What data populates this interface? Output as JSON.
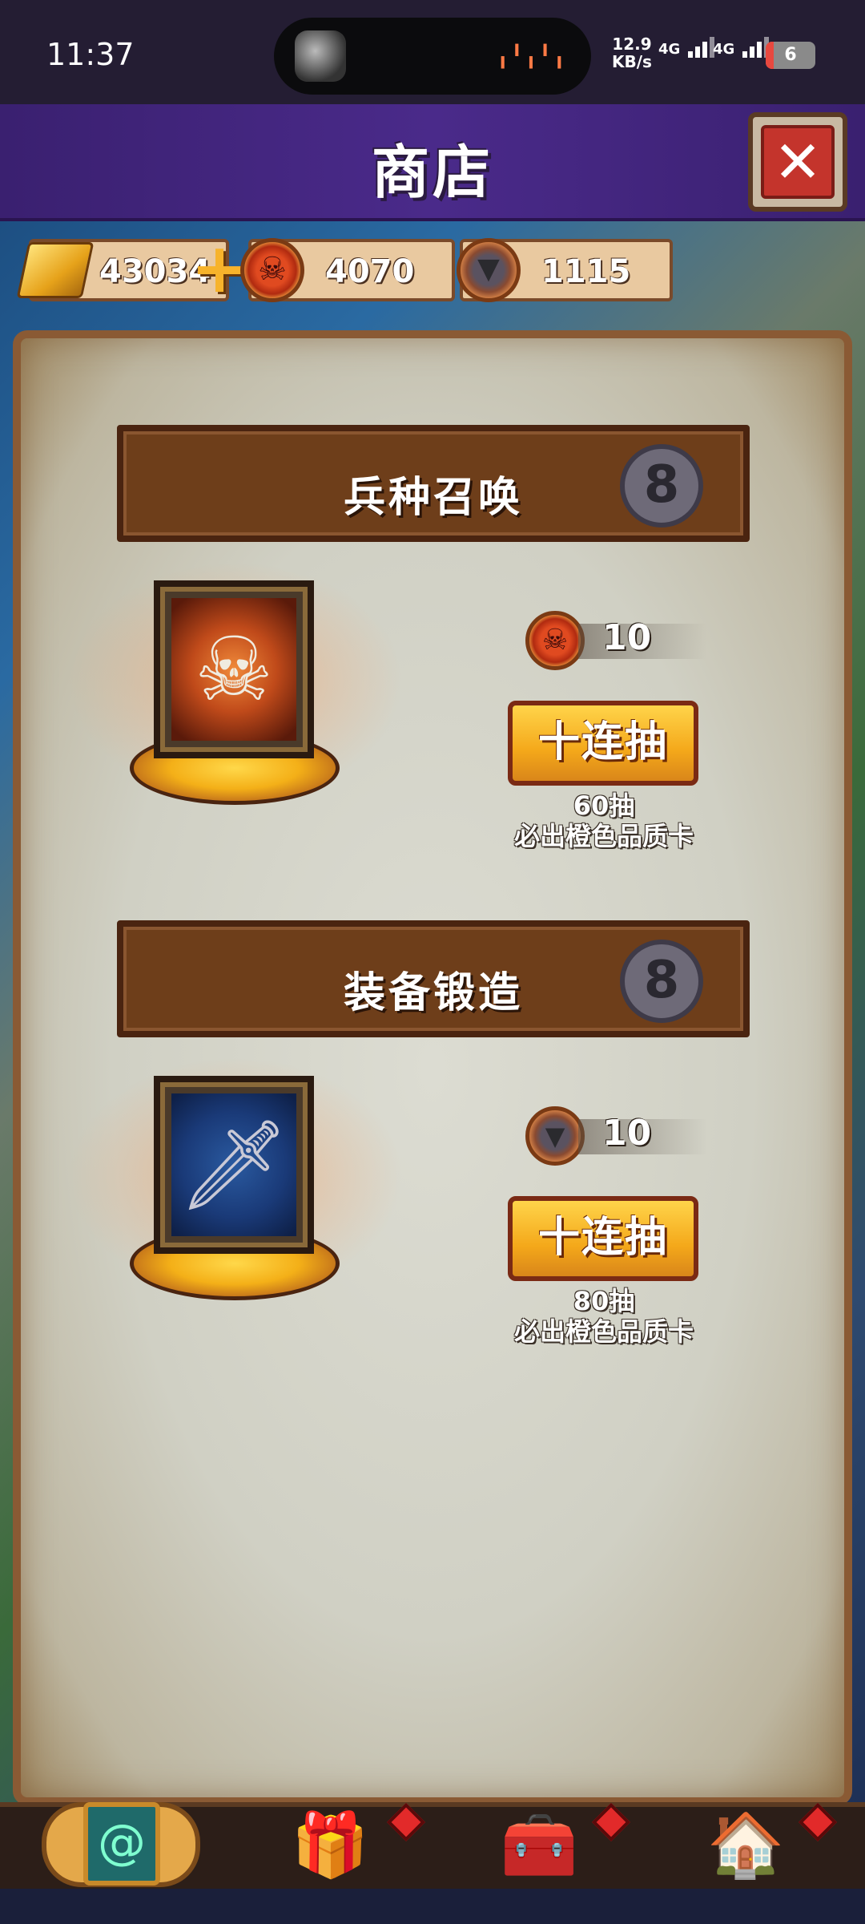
{
  "status_bar": {
    "time": "11:37",
    "net_speed_value": "12.9",
    "net_speed_unit": "KB/s",
    "signal1": "4G",
    "signal2": "4G",
    "battery": "6"
  },
  "header": {
    "title": "商店",
    "close_icon": "close-x-icon"
  },
  "resources": {
    "gold": "43034",
    "demon_token": "4070",
    "anvil_token": "1115"
  },
  "sections": [
    {
      "title": "兵种召唤",
      "badge": "8",
      "card_art": "skeleton-warrior",
      "cost": "10",
      "cost_icon": "demon-coin-icon",
      "button_label": "十连抽",
      "note_line1": "60抽",
      "note_line2": "必出橙色品质卡"
    },
    {
      "title": "装备锻造",
      "badge": "8",
      "card_art": "sword",
      "cost": "10",
      "cost_icon": "anvil-coin-icon",
      "button_label": "十连抽",
      "note_line1": "80抽",
      "note_line2": "必出橙色品质卡"
    }
  ],
  "bottom_nav": {
    "tabs": [
      "card-portal-icon",
      "gift-box-icon",
      "treasure-chest-icon",
      "hero-house-icon"
    ],
    "active_index": 0,
    "accent": "#e4a84a",
    "badge_color": "#e22a2a"
  }
}
